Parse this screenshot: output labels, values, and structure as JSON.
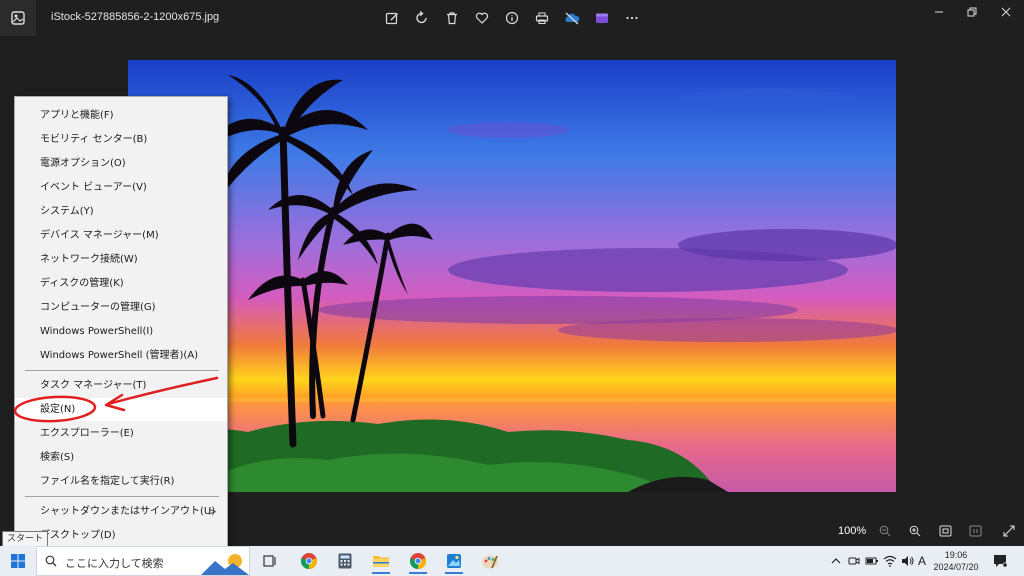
{
  "window": {
    "file_name": "iStock-527885856-2-1200x675.jpg"
  },
  "toolbar": {
    "buttons": [
      "edit-icon",
      "rotate-icon",
      "delete-icon",
      "favorite-icon",
      "info-icon",
      "print-icon",
      "onedrive-icon",
      "clipchamp-icon",
      "more-icon"
    ]
  },
  "zoom": {
    "value": "100%"
  },
  "context_menu": {
    "items": [
      "アプリと機能(F)",
      "モビリティ センター(B)",
      "電源オプション(O)",
      "イベント ビューアー(V)",
      "システム(Y)",
      "デバイス マネージャー(M)",
      "ネットワーク接続(W)",
      "ディスクの管理(K)",
      "コンピューターの管理(G)",
      "Windows PowerShell(I)",
      "Windows PowerShell (管理者)(A)",
      "タスク マネージャー(T)",
      "設定(N)",
      "エクスプローラー(E)",
      "検索(S)",
      "ファイル名を指定して実行(R)",
      "シャットダウンまたはサインアウト(U)",
      "デスクトップ(D)"
    ],
    "highlighted": "設定(N)",
    "submenu_arrow": ">"
  },
  "tooltip": {
    "text": "スタート"
  },
  "taskbar": {
    "search_placeholder": "ここに入力して検索",
    "clock_time": "19:06",
    "clock_date": "2024/07/20",
    "ime_label": "A"
  },
  "colors": {
    "annotation": "#e0201e",
    "taskbar": "#e9eef5",
    "menu_bg": "#f2f2f2"
  }
}
